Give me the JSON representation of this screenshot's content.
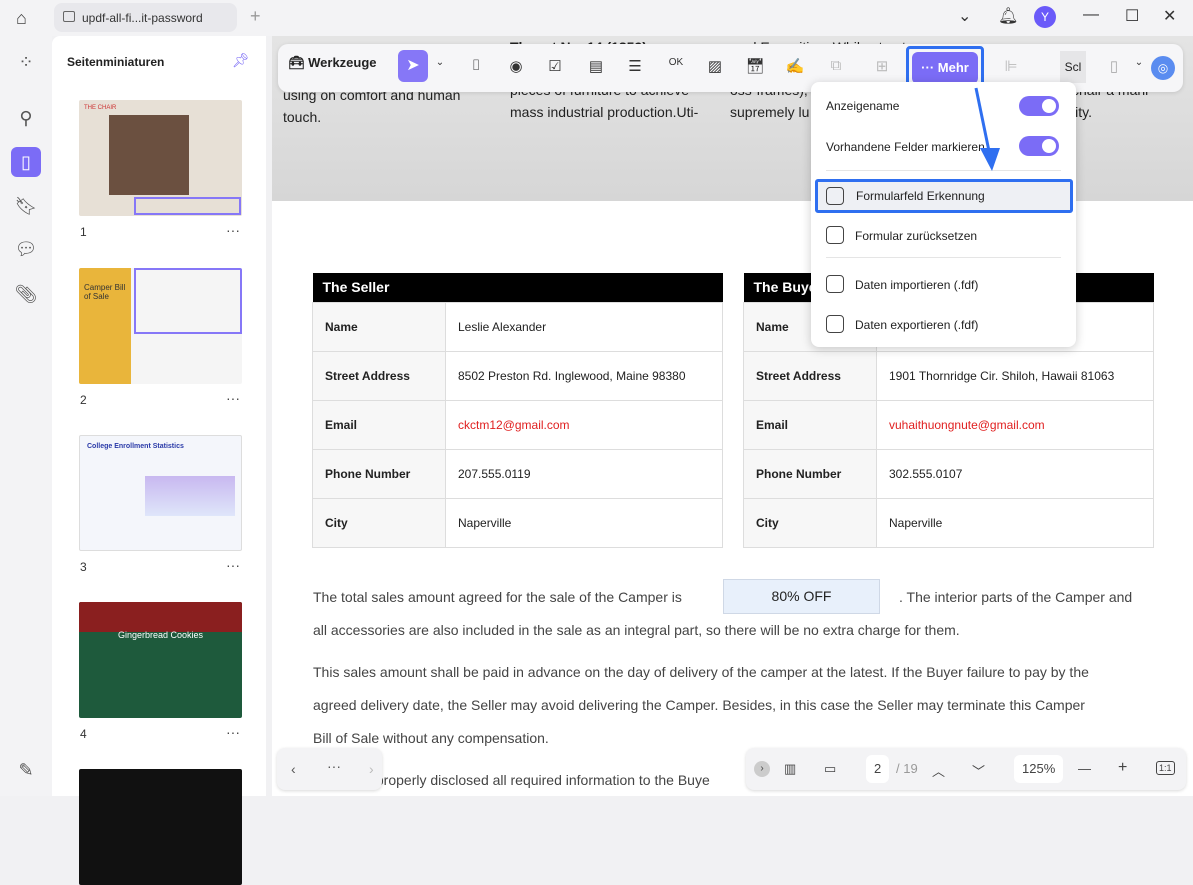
{
  "tab": {
    "title": "updf-all-fi...it-password"
  },
  "user": {
    "initial": "Y"
  },
  "panel": {
    "title": "Seitenminiaturen",
    "thumbs": [
      {
        "n": "1",
        "label": "THE CHAIR"
      },
      {
        "n": "2",
        "label": "Camper Bill of Sale"
      },
      {
        "n": "3",
        "label": "College Enrollment Statistics"
      },
      {
        "n": "4",
        "label": "Gingerbread Cookies"
      }
    ]
  },
  "scan": {
    "col1": [
      "using on comfort and human",
      "touch."
    ],
    "col2": [
      "Thonet No. 14 (1859)",
      "pieces of furniture to achieve",
      "mass industrial production.Uti-"
    ],
    "col3": [
      "anal Exposition. While struct",
      "oss-frames),",
      "supremely lu"
    ],
    "col4": [
      "chair a mani-",
      "lity."
    ]
  },
  "toolbar": {
    "tools": "Werkzeuge",
    "more": "Mehr",
    "sc": "Scl"
  },
  "menu": {
    "items": [
      "Anzeigename",
      "Vorhandene Felder markieren",
      "Formularfeld Erkennung",
      "Formular zurücksetzen",
      "Daten importieren (.fdf)",
      "Daten exportieren (.fdf)"
    ]
  },
  "seller": {
    "title": "The Seller",
    "rows": [
      [
        "Name",
        "Leslie Alexander"
      ],
      [
        "Street Address",
        "8502 Preston Rd. Inglewood, Maine 98380"
      ],
      [
        "Email",
        "ckctm12@gmail.com"
      ],
      [
        "Phone Number",
        "207.555.0119"
      ],
      [
        "City",
        "Naperville"
      ]
    ]
  },
  "buyer": {
    "title": "The Buyer",
    "rows": [
      [
        "Name",
        ""
      ],
      [
        "Street Address",
        "1901 Thornridge Cir. Shiloh, Hawaii 81063"
      ],
      [
        "Email",
        "vuhaithuongnute@gmail.com"
      ],
      [
        "Phone Number",
        "302.555.0107"
      ],
      [
        "City",
        "Naperville"
      ]
    ]
  },
  "body": {
    "p1a": "The total sales amount agreed for the sale of the Camper is",
    "field": "80% OFF",
    "p1b": ". The interior parts of the Camper and",
    "p1c": "all accessories are also included in the sale as an integral part, so there will be no extra charge for them.",
    "p2a": "This sales amount shall be paid in advance on the day of delivery of the camper at the latest. If the Buyer failure to pay by the",
    "p2b": "agreed delivery date, the Seller may avoid delivering the Camper. Besides, in this case the Seller may terminate this Camper",
    "p2c": "Bill of Sale without any compensation.",
    "p3": "s properly disclosed all required information to the Buye"
  },
  "nav": {
    "page": "2",
    "total": "/ 19",
    "zoom": "125%",
    "fit": "1:1"
  }
}
